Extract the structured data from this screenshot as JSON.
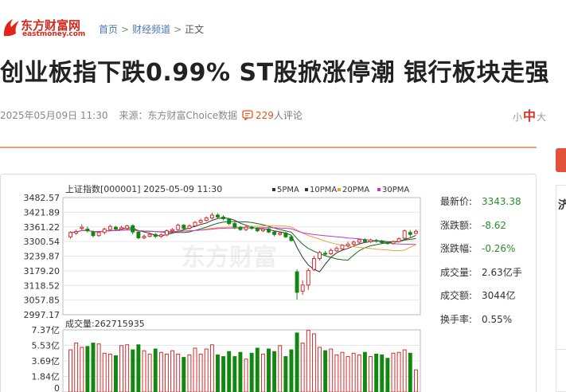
{
  "logo": {
    "cn": "东方财富网",
    "en": "eastmoney.com"
  },
  "breadcrumb": {
    "items": [
      "首页",
      "财经频道"
    ],
    "current": "正文",
    "separator": ">"
  },
  "article": {
    "title": "创业板指下跌0.99% ST股掀涨停潮 银行板块走强",
    "datetime": "2025年05月09日 11:30",
    "source_label": "来源：",
    "source": "东方财富Choice数据",
    "comment_count": "229",
    "comment_suffix": "人评论"
  },
  "font_size": {
    "small": "小",
    "medium": "中",
    "large": "大"
  },
  "sidebar": {
    "label": "济"
  },
  "quote_chart": {
    "header": "上证指数[000001] 2025-05-09 11:30",
    "watermark": "东方财富",
    "legend": [
      {
        "name": "5PMA",
        "color": "#333333"
      },
      {
        "name": "10PMA",
        "color": "#333333"
      },
      {
        "name": "20PMA",
        "color": "#e0a93a"
      },
      {
        "name": "30PMA",
        "color": "#cc33cc"
      }
    ],
    "price_ticks": [
      "3482.57",
      "3421.89",
      "3361.22",
      "3300.54",
      "3239.87",
      "3179.20",
      "3118.52",
      "3057.85",
      "2997.17"
    ],
    "volume_label": "成交量:262715935",
    "volume_ticks": [
      "7.37亿",
      "5.53亿",
      "3.69亿",
      "1.84亿",
      "0"
    ],
    "up_color": "#d42d2d",
    "down_color": "#118811"
  },
  "chart_data": {
    "type": "candlestick",
    "title": "上证指数[000001] 2025-05-09 11:30",
    "ylim": [
      2997.17,
      3482.57
    ],
    "candles": [
      [
        3320,
        3338,
        3343,
        3312
      ],
      [
        3335,
        3342,
        3350,
        3328
      ],
      [
        3355,
        3360,
        3372,
        3348
      ],
      [
        3352,
        3345,
        3362,
        3338
      ],
      [
        3340,
        3325,
        3346,
        3318
      ],
      [
        3325,
        3338,
        3344,
        3320
      ],
      [
        3338,
        3352,
        3358,
        3330
      ],
      [
        3350,
        3363,
        3370,
        3345
      ],
      [
        3360,
        3352,
        3365,
        3346
      ],
      [
        3352,
        3358,
        3366,
        3347
      ],
      [
        3355,
        3365,
        3370,
        3350
      ],
      [
        3366,
        3340,
        3372,
        3330
      ],
      [
        3340,
        3316,
        3345,
        3310
      ],
      [
        3316,
        3322,
        3330,
        3310
      ],
      [
        3322,
        3330,
        3338,
        3318
      ],
      [
        3330,
        3322,
        3336,
        3315
      ],
      [
        3322,
        3328,
        3334,
        3316
      ],
      [
        3328,
        3345,
        3350,
        3322
      ],
      [
        3345,
        3350,
        3356,
        3338
      ],
      [
        3350,
        3368,
        3375,
        3345
      ],
      [
        3368,
        3355,
        3373,
        3350
      ],
      [
        3355,
        3365,
        3372,
        3350
      ],
      [
        3365,
        3380,
        3385,
        3360
      ],
      [
        3380,
        3388,
        3395,
        3375
      ],
      [
        3388,
        3398,
        3405,
        3383
      ],
      [
        3398,
        3410,
        3420,
        3392
      ],
      [
        3410,
        3402,
        3418,
        3395
      ],
      [
        3402,
        3395,
        3410,
        3388
      ],
      [
        3395,
        3375,
        3398,
        3368
      ],
      [
        3375,
        3360,
        3380,
        3352
      ],
      [
        3360,
        3350,
        3365,
        3345
      ],
      [
        3350,
        3360,
        3365,
        3344
      ],
      [
        3360,
        3355,
        3366,
        3349
      ],
      [
        3355,
        3345,
        3360,
        3340
      ],
      [
        3345,
        3352,
        3358,
        3340
      ],
      [
        3352,
        3340,
        3357,
        3335
      ],
      [
        3340,
        3330,
        3345,
        3322
      ],
      [
        3330,
        3336,
        3342,
        3325
      ],
      [
        3336,
        3320,
        3340,
        3315
      ],
      [
        3320,
        3305,
        3325,
        3300
      ],
      [
        3175,
        3090,
        3185,
        3060
      ],
      [
        3095,
        3120,
        3140,
        3080
      ],
      [
        3120,
        3180,
        3190,
        3100
      ],
      [
        3185,
        3230,
        3242,
        3178
      ],
      [
        3230,
        3255,
        3262,
        3222
      ],
      [
        3252,
        3248,
        3262,
        3240
      ],
      [
        3250,
        3264,
        3272,
        3244
      ],
      [
        3262,
        3272,
        3280,
        3258
      ],
      [
        3270,
        3285,
        3290,
        3265
      ],
      [
        3283,
        3290,
        3300,
        3276
      ],
      [
        3290,
        3298,
        3305,
        3284
      ],
      [
        3298,
        3308,
        3312,
        3292
      ],
      [
        3308,
        3300,
        3314,
        3295
      ],
      [
        3300,
        3307,
        3312,
        3295
      ],
      [
        3305,
        3303,
        3311,
        3296
      ],
      [
        3302,
        3296,
        3308,
        3290
      ],
      [
        3296,
        3292,
        3300,
        3288
      ],
      [
        3292,
        3300,
        3305,
        3288
      ],
      [
        3300,
        3312,
        3318,
        3296
      ],
      [
        3314,
        3345,
        3350,
        3310
      ],
      [
        3338,
        3330,
        3348,
        3320
      ],
      [
        3334,
        3343,
        3350,
        3330
      ]
    ],
    "volumes": [
      5.0,
      5.8,
      5.3,
      5.4,
      5.8,
      5.7,
      4.6,
      4.5,
      4.3,
      5.5,
      5.6,
      5.0,
      5.6,
      4.9,
      4.5,
      5.1,
      4.7,
      4.5,
      4.9,
      4.5,
      4.1,
      4.4,
      5.2,
      4.5,
      5.1,
      5.6,
      4.4,
      4.2,
      4.8,
      4.2,
      4.7,
      3.9,
      4.6,
      5.2,
      4.5,
      5.1,
      4.8,
      5.5,
      4.2,
      5.0,
      7.0,
      5.8,
      7.3,
      6.9,
      5.3,
      4.9,
      5.1,
      4.4,
      4.7,
      4.2,
      4.6,
      4.4,
      4.7,
      4.2,
      4.5,
      4.4,
      4.0,
      4.6,
      4.7,
      5.0,
      4.6,
      2.63
    ],
    "vol_ylim": [
      0,
      7.37
    ]
  },
  "quote_panel": [
    {
      "label": "最新价:",
      "value": "3343.38",
      "color": "#2a8c2a"
    },
    {
      "label": "涨跌额:",
      "value": "-8.62",
      "color": "#2a8c2a"
    },
    {
      "label": "涨跌幅:",
      "value": "-0.26%",
      "color": "#2a8c2a"
    },
    {
      "label": "成交量:",
      "value": "2.63亿手",
      "color": "#333333"
    },
    {
      "label": "成交额:",
      "value": "3044亿",
      "color": "#333333"
    },
    {
      "label": "换手率:",
      "value": "0.55%",
      "color": "#333333"
    }
  ]
}
